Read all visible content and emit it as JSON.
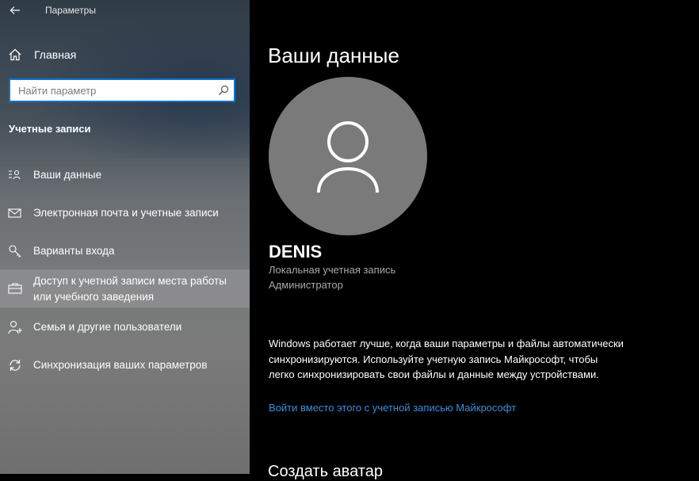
{
  "window": {
    "title": "Параметры"
  },
  "sidebar": {
    "home_label": "Главная",
    "search_placeholder": "Найти параметр",
    "section_title": "Учетные записи",
    "items": [
      {
        "label": "Ваши данные",
        "icon": "person-list-icon"
      },
      {
        "label": "Электронная почта и учетные записи",
        "icon": "mail-icon"
      },
      {
        "label": "Варианты входа",
        "icon": "key-icon"
      },
      {
        "label_line1": "Доступ к учетной записи места работы",
        "label_line2": "или учебного заведения",
        "icon": "briefcase-icon",
        "active": true
      },
      {
        "label": "Семья и другие пользователи",
        "icon": "person-add-icon"
      },
      {
        "label": "Синхронизация ваших параметров",
        "icon": "sync-icon"
      }
    ]
  },
  "main": {
    "title": "Ваши данные",
    "user_name": "DENIS",
    "account_type": "Локальная учетная запись",
    "account_role": "Администратор",
    "info_text": "Windows работает лучше, когда ваши параметры и файлы автоматически синхронизируются. Используйте учетную запись Майкрософт, чтобы легко синхронизировать свои файлы и данные между устройствами.",
    "link_text": "Войти вместо этого с учетной записью Майкрософт",
    "next_section_title": "Создать аватар"
  },
  "colors": {
    "accent": "#0a74d0",
    "link": "#3a8fde",
    "avatar_bg": "#7a7a7a",
    "main_bg": "#000000"
  }
}
